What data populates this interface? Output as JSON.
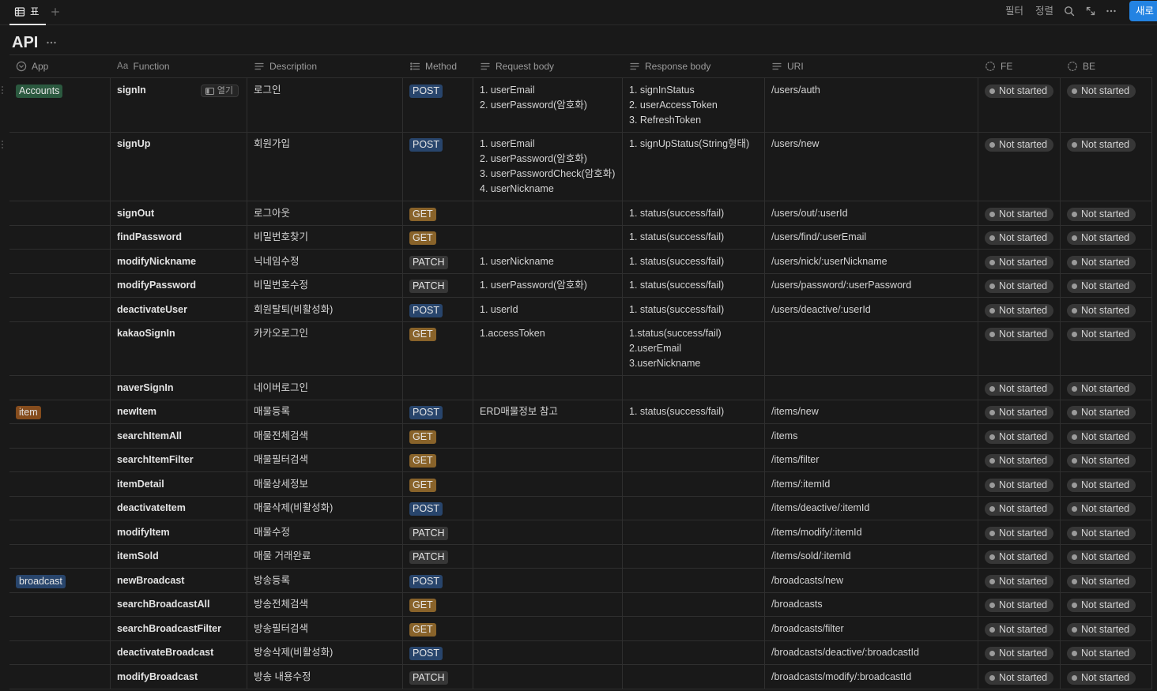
{
  "toolbar": {
    "view_tab_label": "표",
    "view_tab_icon": "table-view-icon",
    "add_view_icon": "plus-icon",
    "filter_label": "필터",
    "sort_label": "정렬",
    "search_icon": "search-icon",
    "expand_icon": "expand-icon",
    "more_icon": "more-icon",
    "new_label": "새로"
  },
  "database": {
    "title": "API",
    "more_icon": "more-icon"
  },
  "columns": [
    {
      "label": "App",
      "icon": "select-property-icon"
    },
    {
      "label": "Function",
      "icon": "title-property-icon",
      "icon_text": "Aa"
    },
    {
      "label": "Description",
      "icon": "text-property-icon"
    },
    {
      "label": "Method",
      "icon": "multi-select-property-icon"
    },
    {
      "label": "Request body",
      "icon": "text-property-icon"
    },
    {
      "label": "Response body",
      "icon": "text-property-icon"
    },
    {
      "label": "URI",
      "icon": "text-property-icon"
    },
    {
      "label": "FE",
      "icon": "status-property-icon"
    },
    {
      "label": "BE",
      "icon": "status-property-icon"
    }
  ],
  "colors": {
    "accent": "#2383e2",
    "app_tags": {
      "Accounts": "#2b593f",
      "item": "#854c1d",
      "broadcast": "#28456c"
    },
    "method_tags": {
      "POST": "#28456c",
      "GET": "#89632a",
      "PATCH": "#373737"
    },
    "status_bg": {
      "Not started": "#373737"
    },
    "status_dot": {
      "Not started": "#9b9b9b"
    }
  },
  "rows": [
    {
      "drag_handle": true,
      "app": "Accounts",
      "function": "signIn",
      "open_label": "열기",
      "description": "로그인",
      "method": "POST",
      "request_body": [
        "1. userEmail",
        "2. userPassword(암호화)"
      ],
      "response_body": [
        "1. signInStatus",
        "2. userAccessToken",
        "3. RefreshToken"
      ],
      "uri": "/users/auth",
      "fe": "Not started",
      "be": "Not started"
    },
    {
      "drag_handle": true,
      "app": "",
      "function": "signUp",
      "description": "회원가입",
      "method": "POST",
      "request_body": [
        "1. userEmail",
        "2. userPassword(암호화)",
        "3. userPasswordCheck(암호화)",
        "4. userNickname"
      ],
      "response_body": [
        "1. signUpStatus(String형태)"
      ],
      "uri": "/users/new",
      "fe": "Not started",
      "be": "Not started"
    },
    {
      "app": "",
      "function": "signOut",
      "description": "로그아웃",
      "method": "GET",
      "request_body": [],
      "response_body": [
        "1. status(success/fail)"
      ],
      "uri": "/users/out/:userId",
      "fe": "Not started",
      "be": "Not started"
    },
    {
      "app": "",
      "function": "findPassword",
      "description": "비밀번호찾기",
      "method": "GET",
      "request_body": [],
      "response_body": [
        "1. status(success/fail)"
      ],
      "uri": "/users/find/:userEmail",
      "fe": "Not started",
      "be": "Not started"
    },
    {
      "app": "",
      "function": "modifyNickname",
      "description": "닉네임수정",
      "method": "PATCH",
      "request_body": [
        "1. userNickname"
      ],
      "response_body": [
        "1. status(success/fail)"
      ],
      "uri": "/users/nick/:userNickname",
      "fe": "Not started",
      "be": "Not started"
    },
    {
      "app": "",
      "function": "modifyPassword",
      "description": "비밀번호수정",
      "method": "PATCH",
      "request_body": [
        "1. userPassword(암호화)"
      ],
      "response_body": [
        "1. status(success/fail)"
      ],
      "uri": "/users/password/:userPassword",
      "fe": "Not started",
      "be": "Not started"
    },
    {
      "app": "",
      "function": "deactivateUser",
      "description": "회원탈퇴(비활성화)",
      "method": "POST",
      "request_body": [
        "1. userId"
      ],
      "response_body": [
        "1. status(success/fail)"
      ],
      "uri": "/users/deactive/:userId",
      "fe": "Not started",
      "be": "Not started"
    },
    {
      "app": "",
      "function": "kakaoSignIn",
      "description": "카카오로그인",
      "method": "GET",
      "request_body": [
        "1.accessToken"
      ],
      "response_body": [
        "1.status(success/fail)",
        "2.userEmail",
        "3.userNickname"
      ],
      "uri": "",
      "fe": "Not started",
      "be": "Not started"
    },
    {
      "app": "",
      "function": "naverSignIn",
      "description": "네이버로그인",
      "method": "",
      "request_body": [],
      "response_body": [],
      "uri": "",
      "fe": "Not started",
      "be": "Not started"
    },
    {
      "app": "item",
      "function": "newItem",
      "description": "매물등록",
      "method": "POST",
      "request_body": [
        "ERD매물정보 참고"
      ],
      "response_body": [
        "1. status(success/fail)"
      ],
      "uri": "/items/new",
      "fe": "Not started",
      "be": "Not started"
    },
    {
      "app": "",
      "function": "searchItemAll",
      "description": "매물전체검색",
      "method": "GET",
      "request_body": [],
      "response_body": [],
      "uri": "/items",
      "fe": "Not started",
      "be": "Not started"
    },
    {
      "app": "",
      "function": "searchItemFilter",
      "description": "매물필터검색",
      "method": "GET",
      "request_body": [],
      "response_body": [],
      "uri": "/items/filter",
      "fe": "Not started",
      "be": "Not started"
    },
    {
      "app": "",
      "function": "itemDetail",
      "description": "매물상세정보",
      "method": "GET",
      "request_body": [],
      "response_body": [],
      "uri": "/items/:itemId",
      "fe": "Not started",
      "be": "Not started"
    },
    {
      "app": "",
      "function": "deactivateItem",
      "description": "매물삭제(비활성화)",
      "method": "POST",
      "request_body": [],
      "response_body": [],
      "uri": "/items/deactive/:itemId",
      "fe": "Not started",
      "be": "Not started"
    },
    {
      "app": "",
      "function": "modifyItem",
      "description": "매물수정",
      "method": "PATCH",
      "request_body": [],
      "response_body": [],
      "uri": "/items/modify/:itemId",
      "fe": "Not started",
      "be": "Not started"
    },
    {
      "app": "",
      "function": "itemSold",
      "description": "매물 거래완료",
      "method": "PATCH",
      "request_body": [],
      "response_body": [],
      "uri": "/items/sold/:itemId",
      "fe": "Not started",
      "be": "Not started"
    },
    {
      "app": "broadcast",
      "function": "newBroadcast",
      "description": "방송등록",
      "method": "POST",
      "request_body": [],
      "response_body": [],
      "uri": "/broadcasts/new",
      "fe": "Not started",
      "be": "Not started"
    },
    {
      "app": "",
      "function": "searchBroadcastAll",
      "description": "방송전체검색",
      "method": "GET",
      "request_body": [],
      "response_body": [],
      "uri": "/broadcasts",
      "fe": "Not started",
      "be": "Not started"
    },
    {
      "app": "",
      "function": "searchBroadcastFilter",
      "description": "방송필터검색",
      "method": "GET",
      "request_body": [],
      "response_body": [],
      "uri": "/broadcasts/filter",
      "fe": "Not started",
      "be": "Not started"
    },
    {
      "app": "",
      "function": "deactivateBroadcast",
      "description": "방송삭제(비활성화)",
      "method": "POST",
      "request_body": [],
      "response_body": [],
      "uri": "/broadcasts/deactive/:broadcastId",
      "fe": "Not started",
      "be": "Not started"
    },
    {
      "app": "",
      "function": "modifyBroadcast",
      "description": "방송 내용수정",
      "method": "PATCH",
      "request_body": [],
      "response_body": [],
      "uri": "/broadcasts/modify/:broadcastId",
      "fe": "Not started",
      "be": "Not started"
    }
  ]
}
